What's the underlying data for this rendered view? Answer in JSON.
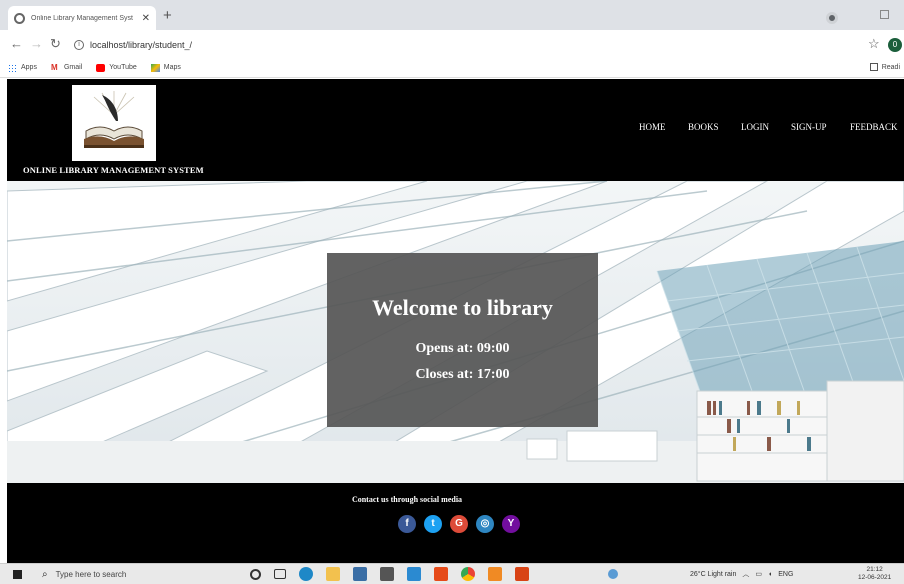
{
  "browser": {
    "tab_title": "Online Library Management Syst",
    "tab_close": "✕",
    "new_tab": "+",
    "url": "localhost/library/student_/",
    "avatar_letter": "0",
    "bookmarks": [
      {
        "label": "Apps",
        "icon": "apps-icon",
        "color": "#1a73e8"
      },
      {
        "label": "Gmail",
        "icon": "gmail-icon",
        "color": "#d93025"
      },
      {
        "label": "YouTube",
        "icon": "youtube-icon",
        "color": "#ff0000"
      },
      {
        "label": "Maps",
        "icon": "maps-icon",
        "color": "#34a853"
      }
    ],
    "reading_list": "Readi"
  },
  "site": {
    "title": "ONLINE LIBRARY MANAGEMENT SYSTEM",
    "nav": [
      "HOME",
      "BOOKS",
      "LOGIN",
      "SIGN-UP",
      "FEEDBACK"
    ]
  },
  "welcome": {
    "title": "Welcome to library",
    "opens": "Opens at: 09:00",
    "closes": "Closes at: 17:00"
  },
  "footer": {
    "contact": "Contact us through social media",
    "socials": [
      {
        "name": "facebook-icon",
        "glyph": "f",
        "color": "#3b5998"
      },
      {
        "name": "twitter-icon",
        "glyph": "t",
        "color": "#1da1f2"
      },
      {
        "name": "google-icon",
        "glyph": "G",
        "color": "#dd4b39"
      },
      {
        "name": "instagram-icon",
        "glyph": "◎",
        "color": "#2e86c1"
      },
      {
        "name": "yahoo-icon",
        "glyph": "Y",
        "color": "#720e9e"
      }
    ]
  },
  "taskbar": {
    "search_placeholder": "Type here to search",
    "weather": "26°C  Light rain",
    "language": "ENG",
    "time": "21:12",
    "date": "12-06-2021"
  }
}
